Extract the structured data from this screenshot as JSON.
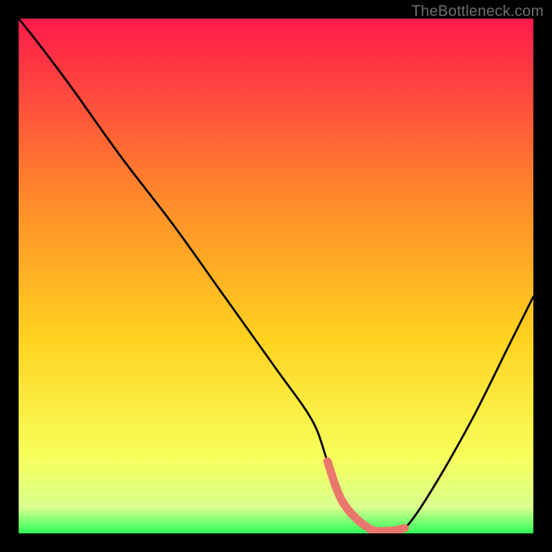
{
  "watermark": "TheBottleneck.com",
  "colors": {
    "bg": "#000000",
    "watermark": "#6d6d6d",
    "curve": "#000000",
    "highlight": "#e9776d",
    "gradient_top": "#ff1a4b",
    "gradient_mid1": "#ff6a3a",
    "gradient_mid2": "#ffd21f",
    "gradient_mid3": "#f7ff5a",
    "gradient_bottom": "#2fff5a"
  },
  "chart_data": {
    "type": "line",
    "title": "",
    "xlabel": "",
    "ylabel": "",
    "xlim": [
      0,
      100
    ],
    "ylim": [
      0,
      100
    ],
    "x": [
      0,
      4,
      10,
      20,
      30,
      40,
      50,
      57,
      60,
      63,
      68,
      72,
      75,
      80,
      88,
      95,
      100
    ],
    "values": [
      100,
      95,
      87,
      73,
      60,
      46,
      32,
      22,
      14,
      6,
      1,
      0.5,
      1,
      8,
      22,
      36,
      46
    ],
    "highlight_range_x": [
      60,
      75
    ],
    "annotations": []
  }
}
